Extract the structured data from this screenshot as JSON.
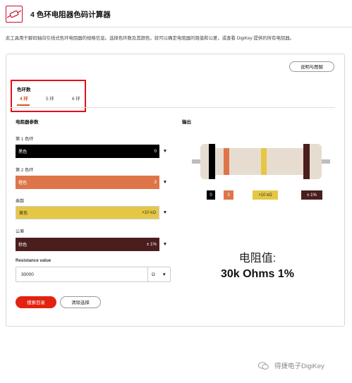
{
  "header": {
    "logo_icon": "resistor-logo-icon",
    "title": "4 色环电阻器色码计算器"
  },
  "description": "此工具用于解码轴向引线式色环电阻器的规格信息。选择色环数及其颜色，就可以确定电阻器的阻值和公差，或查看 DigiKey 提供的所有电阻器。",
  "help_button": "说明与图解",
  "bands": {
    "label": "色环数",
    "tabs": [
      "4 环",
      "5 环",
      "6 环"
    ],
    "active": "4 环"
  },
  "params": {
    "title": "电阻器参数",
    "band1": {
      "label": "第 1 色环",
      "color_name": "黑色",
      "value": "0",
      "color": "#000000"
    },
    "band2": {
      "label": "第 2 色环",
      "color_name": "橙色",
      "value": "3",
      "color": "#de7548"
    },
    "multiplier": {
      "label": "乘数",
      "color_name": "黄色",
      "value": "×10 kΩ",
      "color": "#e6c744"
    },
    "tolerance": {
      "label": "公差",
      "color_name": "棕色",
      "value": "± 1%",
      "color": "#4b1e1e"
    },
    "resistance": {
      "label": "Resistance value",
      "value": "30000",
      "unit": "Ω"
    }
  },
  "buttons": {
    "search": "搜索目录",
    "clear": "清除选择"
  },
  "output": {
    "title": "输出",
    "tags": [
      "0",
      "3",
      "×10 kΩ",
      "± 1%"
    ],
    "result_label": "电阻值:",
    "result_value": "30k Ohms 1%"
  },
  "watermark": "得捷电子DigiKey",
  "colors": {
    "accent_red": "#e3220f",
    "highlight_border": "#e3101c",
    "black": "#000000",
    "orange": "#de7548",
    "yellow": "#e6c744",
    "brown": "#4b1e1e"
  }
}
